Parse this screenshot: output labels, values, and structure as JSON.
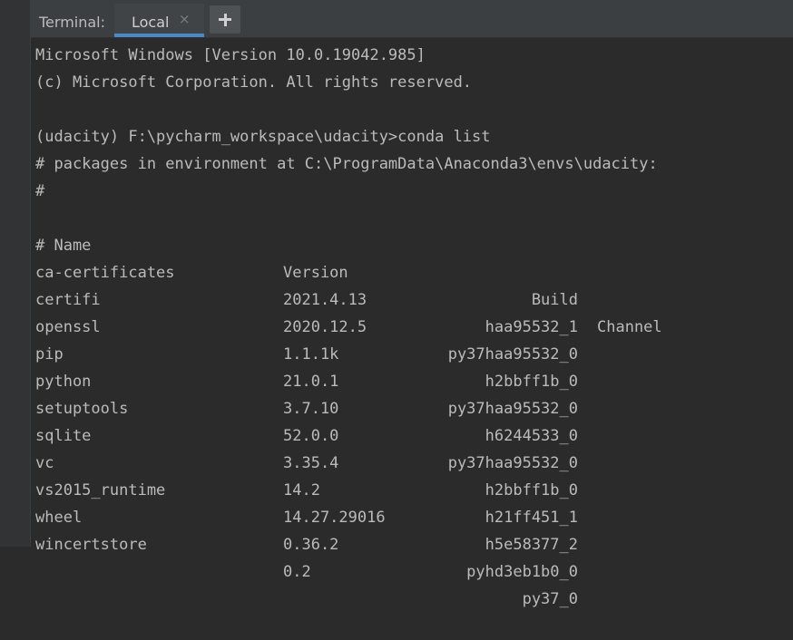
{
  "toolwindow": {
    "title": "Terminal:",
    "tabs": [
      {
        "label": "Local",
        "close": "×",
        "active": true
      }
    ],
    "new_tab": "+"
  },
  "terminal": {
    "lines": [
      "Microsoft Windows [Version 10.0.19042.985]",
      "(c) Microsoft Corporation. All rights reserved.",
      "",
      "(udacity) F:\\pycharm_workspace\\udacity>conda list",
      "# packages in environment at C:\\ProgramData\\Anaconda3\\envs\\udacity:",
      "#"
    ],
    "table": {
      "headers": {
        "name": "# Name",
        "version": "Version",
        "build": "Build",
        "channel": "Channel"
      },
      "rows": [
        {
          "name": "ca-certificates",
          "version": "2021.4.13",
          "build": "haa95532_1",
          "channel": ""
        },
        {
          "name": "certifi",
          "version": "2020.12.5",
          "build": "py37haa95532_0",
          "channel": ""
        },
        {
          "name": "openssl",
          "version": "1.1.1k",
          "build": "h2bbff1b_0",
          "channel": ""
        },
        {
          "name": "pip",
          "version": "21.0.1",
          "build": "py37haa95532_0",
          "channel": ""
        },
        {
          "name": "python",
          "version": "3.7.10",
          "build": "h6244533_0",
          "channel": ""
        },
        {
          "name": "setuptools",
          "version": "52.0.0",
          "build": "py37haa95532_0",
          "channel": ""
        },
        {
          "name": "sqlite",
          "version": "3.35.4",
          "build": "h2bbff1b_0",
          "channel": ""
        },
        {
          "name": "vc",
          "version": "14.2",
          "build": "h21ff451_1",
          "channel": ""
        },
        {
          "name": "vs2015_runtime",
          "version": "14.27.29016",
          "build": "h5e58377_2",
          "channel": ""
        },
        {
          "name": "wheel",
          "version": "0.36.2",
          "build": "pyhd3eb1b0_0",
          "channel": ""
        },
        {
          "name": "wincertstore",
          "version": "0.2",
          "build": "py37_0",
          "channel": ""
        }
      ]
    }
  },
  "colors": {
    "background": "#2b2b2b",
    "tabbar": "#3c3f41",
    "active_tab_underline": "#4a88c7",
    "text": "#bbbbbb"
  }
}
